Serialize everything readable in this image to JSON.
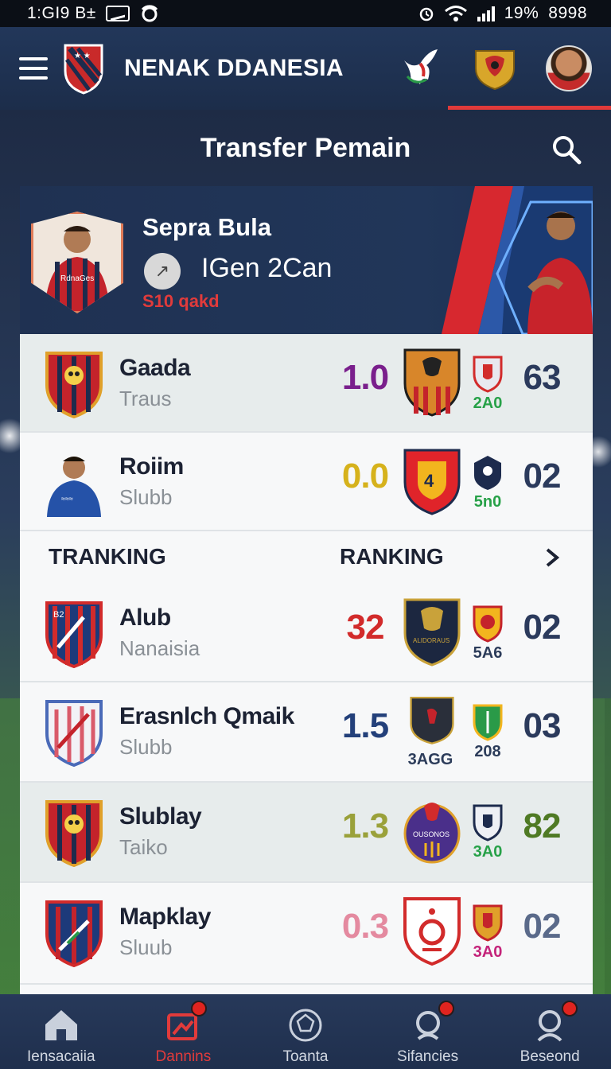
{
  "status_bar": {
    "time": "1:GI9 B±",
    "battery": "19%",
    "right_text": "8998"
  },
  "header": {
    "title": "NENAK DDANESIA",
    "icons": [
      "menu-icon",
      "app-logo-shield",
      "eagle-icon",
      "garuda-crest-icon",
      "profile-avatar"
    ]
  },
  "page": {
    "title": "Transfer Pemain",
    "search_icon": "search-icon"
  },
  "featured": {
    "name": "Sepra Bula",
    "club": "IGen 2Can",
    "sub": "S10 qakd",
    "shirt_text": "RdnaGes"
  },
  "list": [
    {
      "name": "Gaada",
      "sub": "Traus",
      "score": "1.0",
      "score_color": "#7a1f8c",
      "club1_label": "",
      "club2_label": "2A0",
      "pts": "63",
      "pts_color": "#2b3a5c"
    },
    {
      "name": "Roiim",
      "sub": "Slubb",
      "score": "0.0",
      "score_color": "#d6b21c",
      "club1_label": "",
      "club2_label": "5n0",
      "pts": "02",
      "pts_color": "#2b3a5c"
    }
  ],
  "section": {
    "left": "TRANKING",
    "right": "RANKING"
  },
  "ranking": [
    {
      "name": "Alub",
      "sub": "Nanaisia",
      "score": "32",
      "score_color": "#d22b2b",
      "club1_label": "",
      "club2_label": "5A6",
      "pts": "02",
      "pts_color": "#2b3a5c"
    },
    {
      "name": "Erasnlch Qmaik",
      "sub": "Slubb",
      "score": "1.5",
      "score_color": "#23407a",
      "club1_label": "3AGG",
      "club2_label": "208",
      "pts": "03",
      "pts_color": "#2b3a5c"
    },
    {
      "name": "Slublay",
      "sub": "Taiko",
      "score": "1.3",
      "score_color": "#9aa13a",
      "club1_label": "",
      "club2_label": "3A0",
      "pts": "82",
      "pts_color": "#4f7a24"
    },
    {
      "name": "Mapklay",
      "sub": "Sluub",
      "score": "0.3",
      "score_color": "#e48aa0",
      "club1_label": "",
      "club2_label": "3A0",
      "pts": "02",
      "pts_color": "#5a6a8a"
    }
  ],
  "bottom_nav": [
    {
      "label": "Iensacaiia",
      "icon": "home-icon",
      "active": false,
      "badge": false
    },
    {
      "label": "Dannins",
      "icon": "transfer-icon",
      "active": true,
      "badge": true
    },
    {
      "label": "Toanta",
      "icon": "football-icon",
      "active": false,
      "badge": false
    },
    {
      "label": "Sifancies",
      "icon": "stats-icon",
      "active": false,
      "badge": true
    },
    {
      "label": "Beseond",
      "icon": "profile-icon",
      "active": false,
      "badge": true
    }
  ],
  "colors": {
    "accent": "#e13b3b",
    "header_bg": "#1c2d4a",
    "panel_bg": "#f7f8f9"
  }
}
